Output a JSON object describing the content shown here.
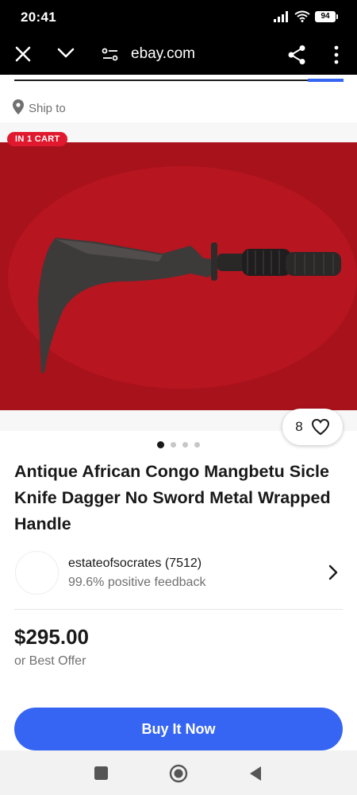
{
  "status_bar": {
    "time": "20:41",
    "battery": "94"
  },
  "browser": {
    "url": "ebay.com"
  },
  "ship_to": {
    "label": "Ship to"
  },
  "gallery": {
    "cart_badge": "IN 1 CART",
    "watch_count": "8",
    "total_images": 4,
    "active_index": 0
  },
  "listing": {
    "title": "Antique African Congo Mangbetu Sicle Knife Dagger No Sword Metal Wrapped Handle",
    "price": "$295.00",
    "offer_text": "or Best Offer",
    "buy_label": "Buy It Now"
  },
  "seller": {
    "name": "estateofsocrates (7512)",
    "feedback": "99.6% positive feedback"
  },
  "colors": {
    "accent": "#3665f3",
    "badge": "#e0192e",
    "photo_background": "#b5141e"
  }
}
